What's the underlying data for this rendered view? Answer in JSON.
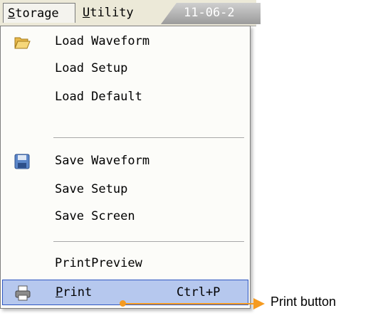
{
  "menubar": {
    "storage_prefix": "S",
    "storage_rest": "torage",
    "utility_prefix": "U",
    "utility_rest": "tility",
    "date_tab": "11-06-2"
  },
  "menu": {
    "items": [
      {
        "label": "Load Waveform",
        "icon": "folder-open-icon"
      },
      {
        "label": "Load Setup"
      },
      {
        "label": "Load Default"
      },
      {
        "label": "Save Waveform",
        "icon": "floppy-disk-icon"
      },
      {
        "label": "Save Setup"
      },
      {
        "label": "Save Screen"
      },
      {
        "label": "PrintPreview"
      },
      {
        "label_prefix": "P",
        "label_rest": "rint",
        "shortcut": "Ctrl+P",
        "icon": "printer-icon"
      }
    ]
  },
  "callout": {
    "text": "Print button"
  },
  "colors": {
    "highlight": "#b6c8ee",
    "callout": "#f59b21"
  }
}
